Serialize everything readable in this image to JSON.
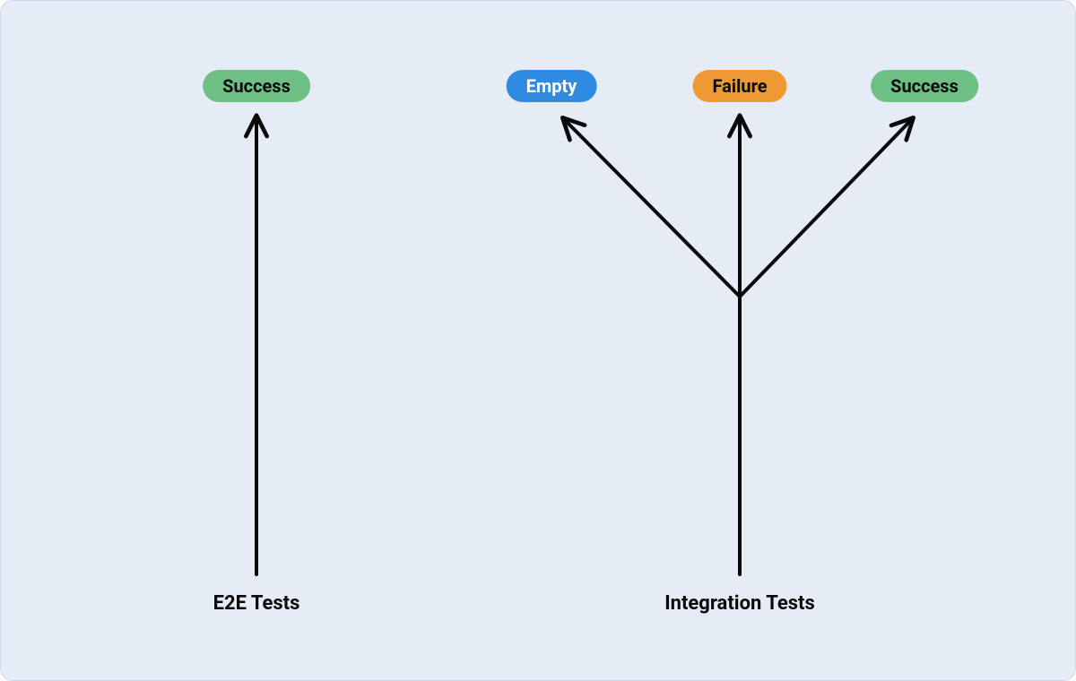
{
  "colors": {
    "background": "#e5ecf6",
    "border": "#d2dbe8",
    "pill_green": "#6dbf84",
    "pill_blue": "#2f8ae2",
    "pill_orange": "#f09a36",
    "arrow": "#0a0a0a",
    "text": "#0a0a0a"
  },
  "left": {
    "caption": "E2E Tests",
    "outcome": "Success"
  },
  "right": {
    "caption": "Integration Tests",
    "outcomes": {
      "empty": "Empty",
      "failure": "Failure",
      "success": "Success"
    }
  }
}
